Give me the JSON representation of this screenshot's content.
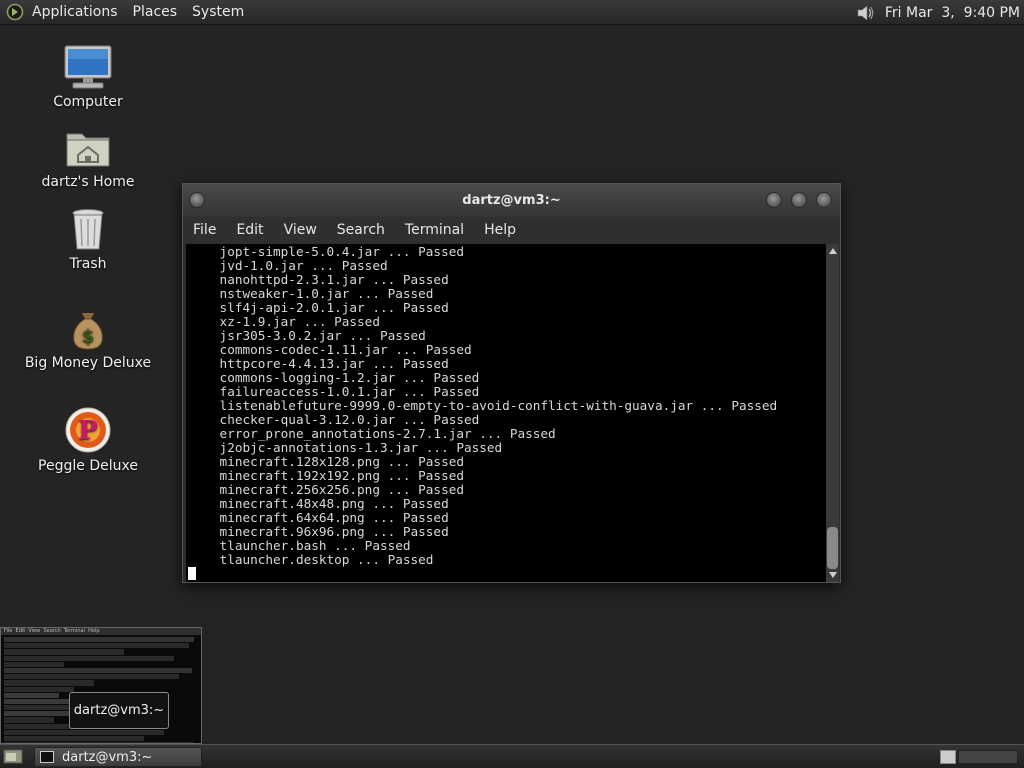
{
  "top_panel": {
    "menus": [
      "Applications",
      "Places",
      "System"
    ],
    "clock": "Fri Mar  3,  9:40 PM"
  },
  "desktop_icons": [
    {
      "label": "Computer",
      "icon": "computer-icon"
    },
    {
      "label": "dartz's Home",
      "icon": "home-folder-icon"
    },
    {
      "label": "Trash",
      "icon": "trash-icon"
    },
    {
      "label": "Big Money Deluxe",
      "icon": "money-bag-icon"
    },
    {
      "label": "Peggle Deluxe",
      "icon": "peggle-icon"
    }
  ],
  "terminal": {
    "title": "dartz@vm3:~",
    "menus": [
      "File",
      "Edit",
      "View",
      "Search",
      "Terminal",
      "Help"
    ],
    "lines": [
      "    jopt-simple-5.0.4.jar ... Passed",
      "    jvd-1.0.jar ... Passed",
      "    nanohttpd-2.3.1.jar ... Passed",
      "    nstweaker-1.0.jar ... Passed",
      "    slf4j-api-2.0.1.jar ... Passed",
      "    xz-1.9.jar ... Passed",
      "    jsr305-3.0.2.jar ... Passed",
      "    commons-codec-1.11.jar ... Passed",
      "    httpcore-4.4.13.jar ... Passed",
      "    commons-logging-1.2.jar ... Passed",
      "    failureaccess-1.0.1.jar ... Passed",
      "    listenablefuture-9999.0-empty-to-avoid-conflict-with-guava.jar ... Passed",
      "    checker-qual-3.12.0.jar ... Passed",
      "    error_prone_annotations-2.7.1.jar ... Passed",
      "    j2objc-annotations-1.3.jar ... Passed",
      "    minecraft.128x128.png ... Passed",
      "    minecraft.192x192.png ... Passed",
      "    minecraft.256x256.png ... Passed",
      "    minecraft.48x48.png ... Passed",
      "    minecraft.64x64.png ... Passed",
      "    minecraft.96x96.png ... Passed",
      "    tlauncher.bash ... Passed",
      "    tlauncher.desktop ... Passed"
    ]
  },
  "preview": {
    "menu_text": "File  Edit  View  Search  Terminal  Help",
    "tooltip": "dartz@vm3:~"
  },
  "taskbar": {
    "task_label": "dartz@vm3:~"
  }
}
